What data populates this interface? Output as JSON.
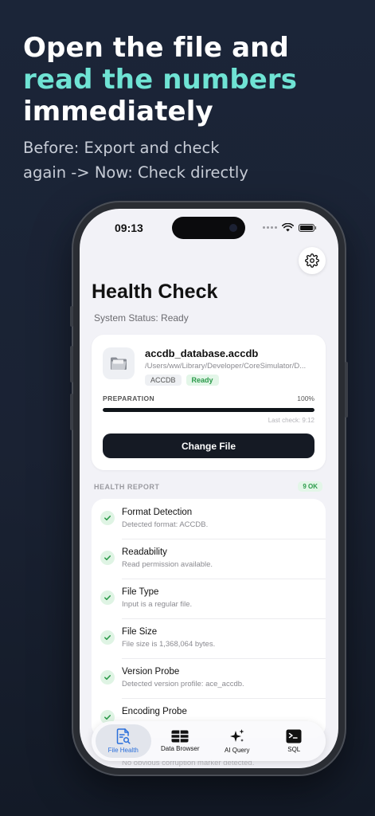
{
  "hero": {
    "line1": "Open the file and",
    "line2": "read the numbers",
    "line3": "immediately",
    "sub1": "Before: Export and check",
    "sub2": "again -> Now: Check directly",
    "accent_color": "#6fe3d4"
  },
  "status_bar": {
    "time": "09:13"
  },
  "screen": {
    "title": "Health Check",
    "system_status": "System Status: Ready"
  },
  "file_card": {
    "name": "accdb_database.accdb",
    "path": "/Users/ww/Library/Developer/CoreSimulator/D...",
    "chips": [
      "ACCDB",
      "Ready"
    ],
    "prep_label": "PREPARATION",
    "prep_percent": "100%",
    "progress": 1.0,
    "last_check": "Last check: 9:12",
    "button_label": "Change File"
  },
  "report": {
    "header": "HEALTH REPORT",
    "badge": "9 OK",
    "items": [
      {
        "title": "Format Detection",
        "sub": "Detected format: ACCDB."
      },
      {
        "title": "Readability",
        "sub": "Read permission available."
      },
      {
        "title": "File Type",
        "sub": "Input is a regular file."
      },
      {
        "title": "File Size",
        "sub": "File size is 1,368,064 bytes."
      },
      {
        "title": "Version Probe",
        "sub": "Detected version profile: ace_accdb."
      },
      {
        "title": "Encoding Probe",
        "sub": ""
      }
    ],
    "hidden_tail": "No obvious corruption marker detected."
  },
  "tabbar": {
    "tabs": [
      {
        "label": "File Health",
        "icon": "file-search-icon",
        "active": true
      },
      {
        "label": "Data Browser",
        "icon": "table-grid-icon",
        "active": false
      },
      {
        "label": "AI Query",
        "icon": "sparkle-icon",
        "active": false
      },
      {
        "label": "SQL",
        "icon": "terminal-icon",
        "active": false
      }
    ]
  },
  "colors": {
    "active_tab": "#2a6fdb",
    "ok_green": "#2b9a4a",
    "button_dark": "#151a24"
  }
}
